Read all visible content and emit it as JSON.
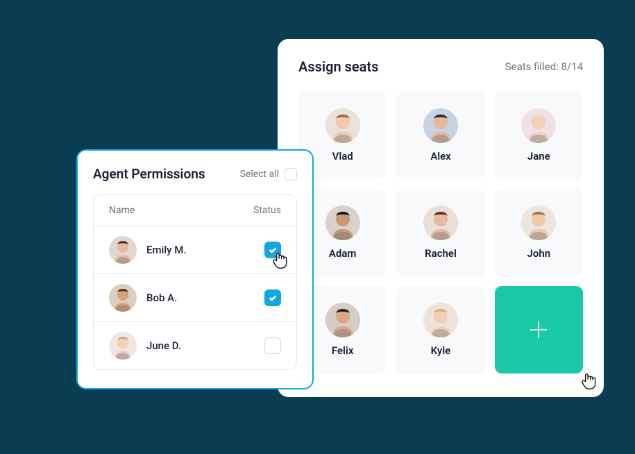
{
  "assign": {
    "title": "Assign seats",
    "status": "Seats filled: 8/14",
    "seats": [
      {
        "name": "Vlad",
        "avatar_bg": "#e8e2da",
        "skin": "#f0c9a8",
        "hair": "#8b6f4e"
      },
      {
        "name": "Alex",
        "avatar_bg": "#c7d4e0",
        "skin": "#e8b89c",
        "hair": "#3a2a1e"
      },
      {
        "name": "Jane",
        "avatar_bg": "#f0e0e8",
        "skin": "#f2d0b8",
        "hair": "#e8d8c8"
      },
      {
        "name": "Adam",
        "avatar_bg": "#d8d2ca",
        "skin": "#c89878",
        "hair": "#1a1a1a"
      },
      {
        "name": "Rachel",
        "avatar_bg": "#e8e0d8",
        "skin": "#e8b89c",
        "hair": "#5a3a2a"
      },
      {
        "name": "John",
        "avatar_bg": "#ece6de",
        "skin": "#f0c9a8",
        "hair": "#9a7a5a"
      },
      {
        "name": "Felix",
        "avatar_bg": "#d4cec6",
        "skin": "#d8a888",
        "hair": "#2a2017"
      },
      {
        "name": "Kyle",
        "avatar_bg": "#ece4da",
        "skin": "#f2d0b8",
        "hair": "#d8b088"
      }
    ]
  },
  "permissions": {
    "title": "Agent Permissions",
    "select_all_label": "Select all",
    "columns": {
      "name": "Name",
      "status": "Status"
    },
    "agents": [
      {
        "name": "Emily M.",
        "avatar_bg": "#e0d8d0",
        "skin": "#e8b89c",
        "hair": "#3a2a1e",
        "checked": true,
        "cursor": true
      },
      {
        "name": "Bob A.",
        "avatar_bg": "#d8cec2",
        "skin": "#d8a078",
        "hair": "#4a3020",
        "checked": true,
        "cursor": false
      },
      {
        "name": "June D.",
        "avatar_bg": "#f0e8e0",
        "skin": "#f2d0b8",
        "hair": "#c8a888",
        "checked": false,
        "cursor": false
      }
    ]
  },
  "colors": {
    "accent_teal": "#1cc9a6",
    "accent_blue": "#13a6e0",
    "bg_dark": "#0a3d52"
  }
}
